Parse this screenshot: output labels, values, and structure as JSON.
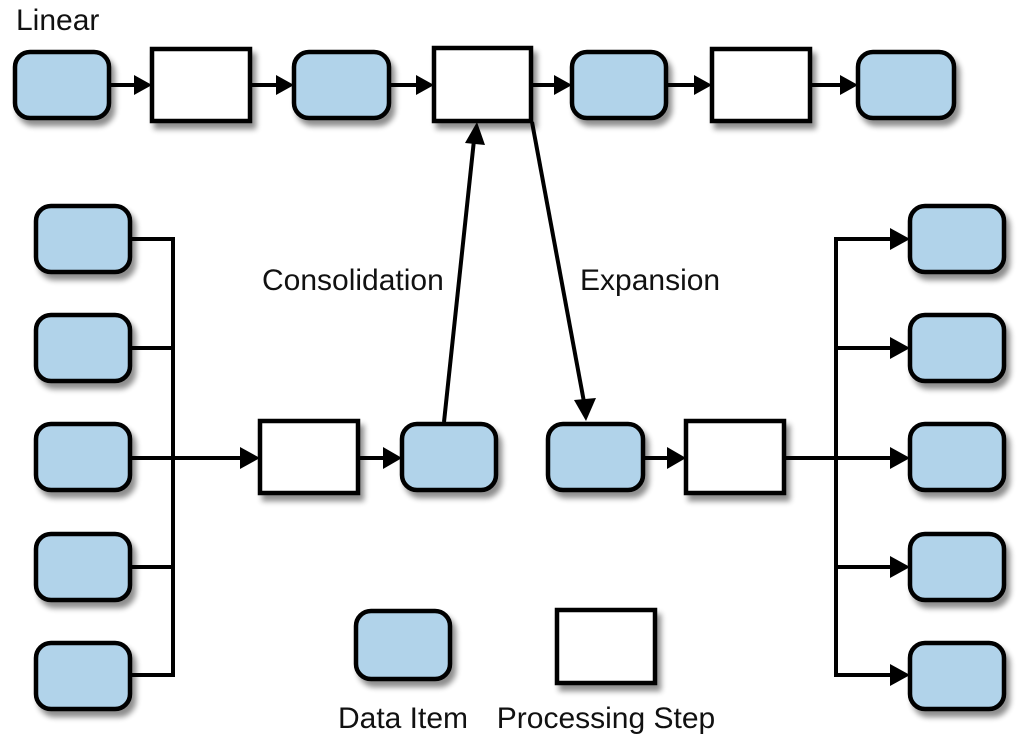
{
  "labels": {
    "linear": "Linear",
    "consolidation": "Consolidation",
    "expansion": "Expansion"
  },
  "legend": {
    "data_item": "Data Item",
    "processing_step": "Processing Step"
  },
  "colors": {
    "data_item_fill": "#b1d3ea",
    "processing_step_fill": "#ffffff",
    "stroke": "#000000"
  },
  "flows": {
    "linear": [
      "data-item",
      "processing-step",
      "data-item",
      "processing-step",
      "data-item",
      "processing-step",
      "data-item"
    ],
    "consolidation_inputs": 5,
    "expansion_outputs": 5
  }
}
